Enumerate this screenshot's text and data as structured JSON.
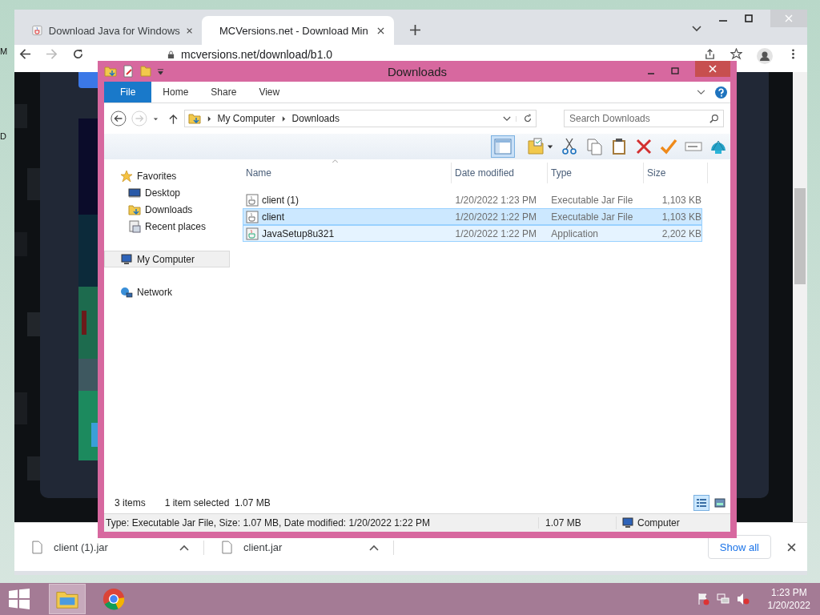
{
  "edge_letters": [
    "M",
    "D"
  ],
  "browser": {
    "tabs": [
      {
        "title": "Download Java for Windows",
        "selected": false
      },
      {
        "title": "MCVersions.net - Download Min",
        "selected": true
      }
    ],
    "address": "mcversions.net/download/b1.0",
    "downloads": [
      {
        "file": "client (1).jar"
      },
      {
        "file": "client.jar"
      }
    ],
    "show_all": "Show all"
  },
  "explorer": {
    "title": "Downloads",
    "ribbon_tabs": [
      {
        "label": "File",
        "selected": true
      },
      {
        "label": "Home",
        "selected": false
      },
      {
        "label": "Share",
        "selected": false
      },
      {
        "label": "View",
        "selected": false
      }
    ],
    "breadcrumb": [
      "My Computer",
      "Downloads"
    ],
    "search": {
      "placeholder": "Search Downloads"
    },
    "nav": [
      {
        "label": "Favorites",
        "kind": "favorites",
        "selected": false,
        "children": [
          {
            "label": "Desktop",
            "kind": "desktop",
            "selected": false
          },
          {
            "label": "Downloads",
            "kind": "downloads",
            "selected": false
          },
          {
            "label": "Recent places",
            "kind": "recent",
            "selected": false
          }
        ]
      },
      {
        "label": "My Computer",
        "kind": "computer",
        "selected": true
      },
      {
        "label": "Network",
        "kind": "network",
        "selected": false
      }
    ],
    "columns": [
      "Name",
      "Date modified",
      "Type",
      "Size"
    ],
    "files": [
      {
        "name": "client (1)",
        "date": "1/20/2022 1:23 PM",
        "type": "Executable Jar File",
        "size": "1,103 KB",
        "kind": "jar",
        "selected": false,
        "hovered": false
      },
      {
        "name": "client",
        "date": "1/20/2022 1:22 PM",
        "type": "Executable Jar File",
        "size": "1,103 KB",
        "kind": "jar",
        "selected": true,
        "hovered": false
      },
      {
        "name": "JavaSetup8u321",
        "date": "1/20/2022 1:22 PM",
        "type": "Application",
        "size": "2,202 KB",
        "kind": "app",
        "selected": false,
        "hovered": true
      }
    ],
    "item_count": "3 items",
    "selection_info": "1 item selected  1.07 MB",
    "views": [
      {
        "kind": "details",
        "selected": true
      },
      {
        "kind": "tiles",
        "selected": false
      }
    ],
    "status_bar": {
      "details": "Type: Executable Jar File, Size: 1.07 MB, Date modified: 1/20/2022 1:22 PM",
      "size": "1.07 MB",
      "location": "Computer"
    }
  },
  "taskbar": {
    "apps": [
      {
        "kind": "explorer",
        "selected": true
      },
      {
        "kind": "chrome",
        "selected": false
      }
    ],
    "time": "1:23 PM",
    "date": "1/20/2022"
  }
}
